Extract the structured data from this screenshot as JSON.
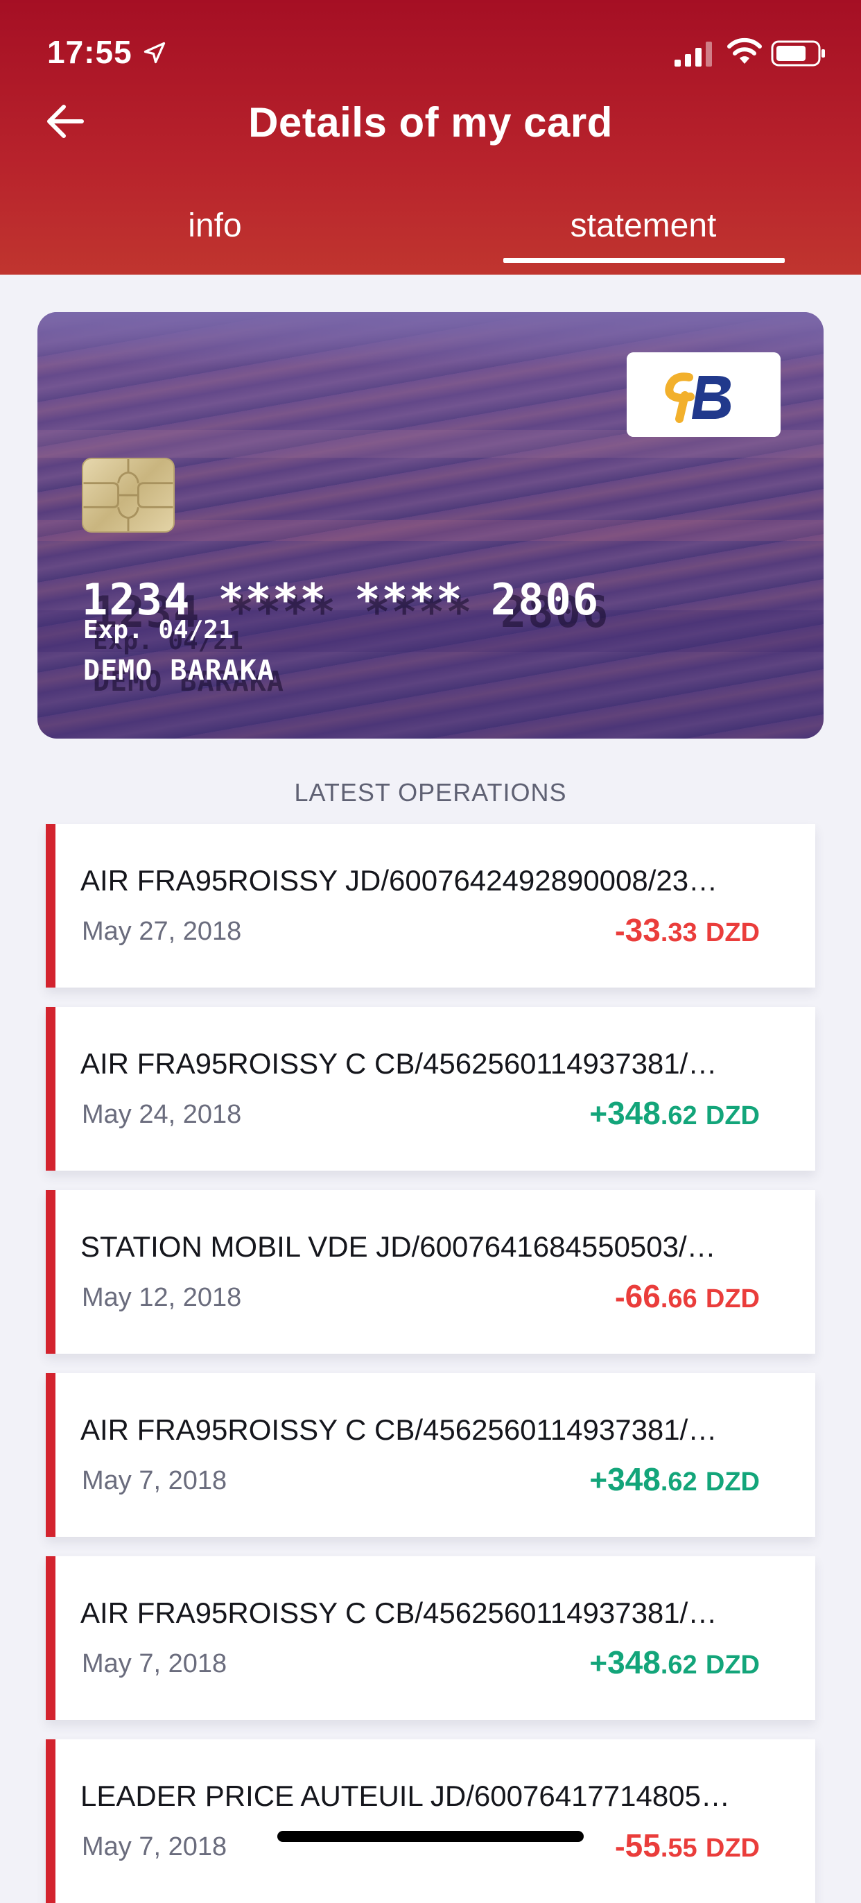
{
  "status_bar": {
    "time": "17:55",
    "icons": [
      "location-arrow-icon",
      "signal-icon",
      "wifi-icon",
      "battery-icon"
    ]
  },
  "header": {
    "title": "Details of my card",
    "back_icon": "arrow-left-icon",
    "tabs": [
      {
        "label": "info",
        "active": false
      },
      {
        "label": "statement",
        "active": true
      }
    ]
  },
  "card": {
    "number": "1234 **** **** 2806",
    "expiry": "Exp. 04/21",
    "holder": "DEMO BARAKA",
    "logo": "bank-logo",
    "chip": "chip-icon"
  },
  "operations": {
    "title": "LATEST OPERATIONS",
    "items": [
      {
        "description": "AIR FRA95ROISSY JD/6007642492890008/23…",
        "date": "May 27, 2018",
        "sign": "-",
        "amount_int": "33",
        "amount_dec": ".33",
        "currency": "DZD",
        "type": "debit"
      },
      {
        "description": "AIR FRA95ROISSY C CB/4562560114937381/…",
        "date": "May 24, 2018",
        "sign": "+",
        "amount_int": "348",
        "amount_dec": ".62",
        "currency": "DZD",
        "type": "credit"
      },
      {
        "description": "STATION MOBIL VDE JD/6007641684550503/…",
        "date": "May 12, 2018",
        "sign": "-",
        "amount_int": "66",
        "amount_dec": ".66",
        "currency": "DZD",
        "type": "debit"
      },
      {
        "description": "AIR FRA95ROISSY C CB/4562560114937381/…",
        "date": "May 7, 2018",
        "sign": "+",
        "amount_int": "348",
        "amount_dec": ".62",
        "currency": "DZD",
        "type": "credit"
      },
      {
        "description": "AIR FRA95ROISSY C CB/4562560114937381/…",
        "date": "May 7, 2018",
        "sign": "+",
        "amount_int": "348",
        "amount_dec": ".62",
        "currency": "DZD",
        "type": "credit"
      },
      {
        "description": "LEADER PRICE AUTEUIL JD/60076417714805…",
        "date": "May 7, 2018",
        "sign": "-",
        "amount_int": "55",
        "amount_dec": ".55",
        "currency": "DZD",
        "type": "debit"
      }
    ]
  },
  "colors": {
    "header_red": "#b01a28",
    "accent_red": "#d3232e",
    "negative": "#ea3d3b",
    "positive": "#13a57a",
    "background": "#f2f2f8"
  }
}
